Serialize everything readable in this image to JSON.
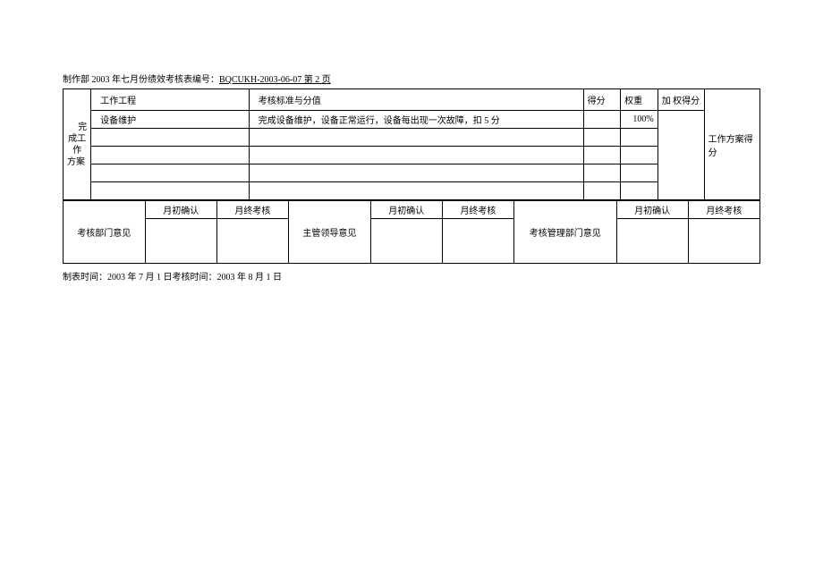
{
  "header": {
    "prefix": "制作部 2003 年七月份绩效考核表编号：",
    "doc_number": "BQCUKH-2003-06-07 第 2 页"
  },
  "main_table": {
    "side_label_line1": "完",
    "side_label_line2": "成工作",
    "side_label_line3": "方案",
    "columns": {
      "task": "工作工程",
      "standard": "考核标准与分值",
      "score": "得分",
      "weight": "权重",
      "wscore": "加 权得分",
      "plan": "工作方案得分"
    },
    "rows": [
      {
        "task": "设备维护",
        "standard": "完成设备维护，设备正常运行，设备每出现一次故障，扣 5 分",
        "score": "",
        "weight": "100%",
        "wscore": "",
        "plan": ""
      },
      {
        "task": "",
        "standard": "",
        "score": "",
        "weight": "",
        "wscore": "",
        "plan": ""
      },
      {
        "task": "",
        "standard": "",
        "score": "",
        "weight": "",
        "wscore": "",
        "plan": ""
      },
      {
        "task": "",
        "standard": "",
        "score": "",
        "weight": "",
        "wscore": "",
        "plan": ""
      },
      {
        "task": "",
        "standard": "",
        "score": "",
        "weight": "",
        "wscore": "",
        "plan": ""
      }
    ]
  },
  "signature": {
    "labels": {
      "dept": "考核部门意见",
      "leader": "主管领导意见",
      "mgmt": "考核管理部门意见"
    },
    "cols": {
      "confirm": "月初确认",
      "assess": "月终考核"
    }
  },
  "footer": {
    "text": "制表时间：2003 年 7 月 1 日考核时间：2003 年 8 月 1 日"
  }
}
